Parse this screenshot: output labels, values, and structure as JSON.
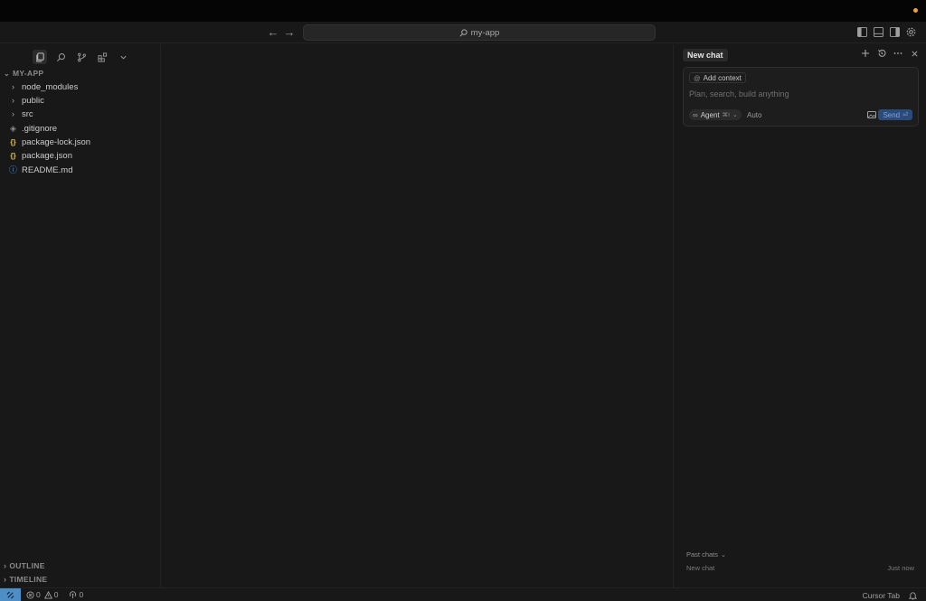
{
  "titlebar": {
    "back_icon": "arrow-left-icon",
    "forward_icon": "arrow-right-icon",
    "search_text": "my-app",
    "layout_buttons": [
      "toggle-primary-sidebar-icon",
      "toggle-panel-icon",
      "toggle-secondary-sidebar-icon",
      "settings-gear-icon"
    ]
  },
  "sidebar": {
    "activity_icons": [
      "files-icon",
      "search-icon",
      "source-control-icon",
      "extensions-icon",
      "chevron-down-icon"
    ],
    "root_label": "MY-APP",
    "tree": [
      {
        "name": "node_modules",
        "type": "folder",
        "icon": "›"
      },
      {
        "name": "public",
        "type": "folder",
        "icon": "›"
      },
      {
        "name": "src",
        "type": "folder",
        "icon": "›"
      },
      {
        "name": ".gitignore",
        "type": "file",
        "icon": "◈"
      },
      {
        "name": "package-lock.json",
        "type": "json",
        "icon": "{}"
      },
      {
        "name": "package.json",
        "type": "json",
        "icon": "{}"
      },
      {
        "name": "README.md",
        "type": "info",
        "icon": "ⓘ"
      }
    ],
    "outline_label": "OUTLINE",
    "timeline_label": "TIMELINE"
  },
  "chat": {
    "tab_title": "New chat",
    "add_context_label": "Add context",
    "prompt_placeholder": "Plan, search, build anything",
    "agent_label": "Agent",
    "agent_shortcut": "⌘I",
    "model_label": "Auto",
    "send_label": "Send",
    "send_shortcut": "⏎",
    "past_chats_label": "Past chats",
    "past_chats": [
      {
        "title": "New chat",
        "time": "Just now"
      }
    ]
  },
  "statusbar": {
    "errors": "0",
    "warnings": "0",
    "ports": "0",
    "cursor_tab_label": "Cursor Tab"
  },
  "colors": {
    "accent": "#4d8ec6",
    "json_icon": "#e2c94f",
    "info_icon": "#5aa0e0",
    "notification_dot": "#e8a33d"
  }
}
